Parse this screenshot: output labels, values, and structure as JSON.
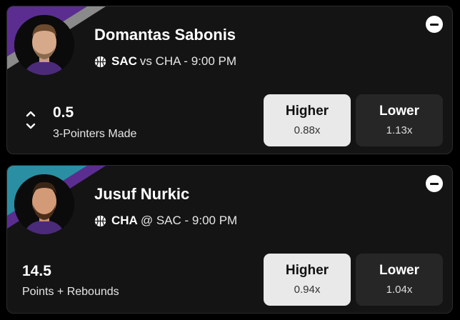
{
  "picks": [
    {
      "player": "Domantas Sabonis",
      "team": "SAC",
      "matchup": "vs CHA - 9:00 PM",
      "line": "0.5",
      "stat": "3-Pointers Made",
      "higher": {
        "label": "Higher",
        "multiplier": "0.88x"
      },
      "lower": {
        "label": "Lower",
        "multiplier": "1.13x"
      },
      "avatar_icon": "player-headshot",
      "sport_icon": "basketball-icon",
      "accent_colors": [
        "#5b2d91",
        "#8a8a8a"
      ]
    },
    {
      "player": "Jusuf Nurkic",
      "team": "CHA",
      "matchup": "@ SAC - 9:00 PM",
      "line": "14.5",
      "stat": "Points + Rebounds",
      "higher": {
        "label": "Higher",
        "multiplier": "0.94x"
      },
      "lower": {
        "label": "Lower",
        "multiplier": "1.04x"
      },
      "avatar_icon": "player-headshot",
      "sport_icon": "basketball-icon",
      "accent_colors": [
        "#2a8fa3",
        "#5b2d91"
      ]
    }
  ],
  "colors": {
    "card_bg": "#141414",
    "higher_bg": "#e9e9e9",
    "lower_bg": "#262626"
  }
}
